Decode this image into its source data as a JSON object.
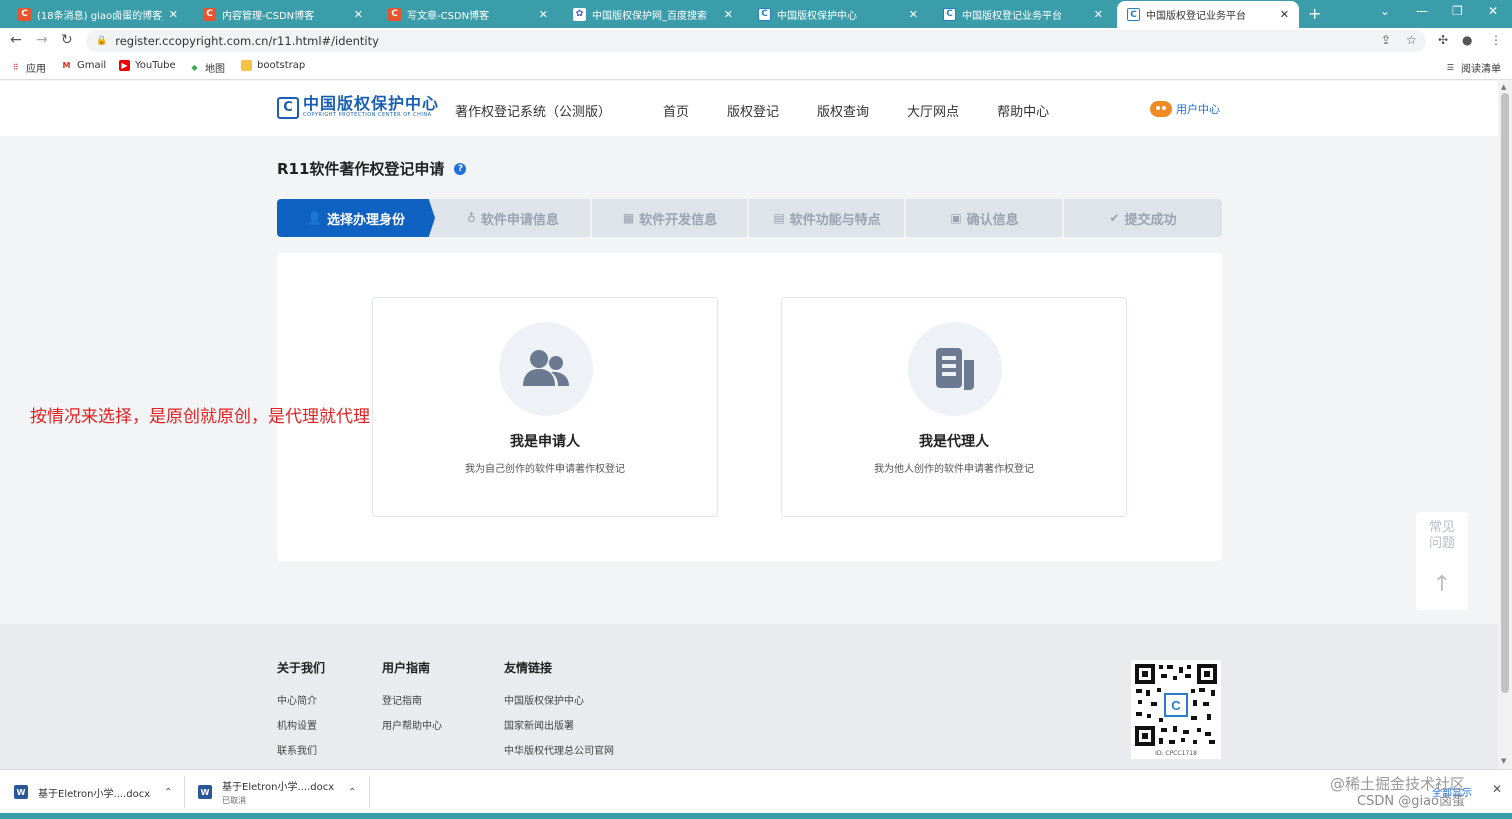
{
  "browser": {
    "tabs": [
      {
        "title": "(18条消息) giao卤蛋的博客_CSDN",
        "icon": "csdn-icon"
      },
      {
        "title": "内容管理-CSDN博客",
        "icon": "csdn-icon"
      },
      {
        "title": "写文章-CSDN博客",
        "icon": "csdn-icon"
      },
      {
        "title": "中国版权保护网_百度搜索",
        "icon": "baidu-icon"
      },
      {
        "title": "中国版权保护中心",
        "icon": "cpcc-icon"
      },
      {
        "title": "中国版权登记业务平台",
        "icon": "cpcc-icon"
      },
      {
        "title": "中国版权登记业务平台",
        "icon": "cpcc-icon"
      }
    ],
    "url": "register.ccopyright.com.cn/r11.html#/identity",
    "bookmarks": [
      {
        "label": "应用"
      },
      {
        "label": "Gmail"
      },
      {
        "label": "YouTube"
      },
      {
        "label": "地图"
      },
      {
        "label": "bootstrap"
      }
    ],
    "reading_list": "阅读清单"
  },
  "site": {
    "logo_text": "中国版权保护中心",
    "logo_sub": "COPYRIGHT PROTECTION CENTER OF CHINA",
    "logo_mark": "C",
    "system_name": "著作权登记系统（公测版）",
    "nav": [
      "首页",
      "版权登记",
      "版权查询",
      "大厅网点",
      "帮助中心"
    ],
    "user_center": "用户中心"
  },
  "page": {
    "title": "R11软件著作权登记申请",
    "help_mark": "?",
    "steps": [
      {
        "label": "选择办理身份",
        "icon": "user-icon",
        "active": true
      },
      {
        "label": "软件申请信息",
        "icon": "bulb-icon",
        "active": false
      },
      {
        "label": "软件开发信息",
        "icon": "calendar-icon",
        "active": false
      },
      {
        "label": "软件功能与特点",
        "icon": "document-icon",
        "active": false
      },
      {
        "label": "确认信息",
        "icon": "clipboard-icon",
        "active": false
      },
      {
        "label": "提交成功",
        "icon": "check-circle-icon",
        "active": false
      }
    ],
    "cards": [
      {
        "title": "我是申请人",
        "desc": "我为自己创作的软件申请著作权登记",
        "icon": "users-icon"
      },
      {
        "title": "我是代理人",
        "desc": "我为他人创作的软件申请著作权登记",
        "icon": "file-stack-icon"
      }
    ],
    "annotation": "按情况来选择，是原创就原创，是代理就代理",
    "float_help": {
      "label_line1": "常见",
      "label_line2": "问题",
      "top_arrow": "↑"
    }
  },
  "footer": {
    "columns": [
      {
        "heading": "关于我们",
        "links": [
          "中心简介",
          "机构设置",
          "联系我们"
        ]
      },
      {
        "heading": "用户指南",
        "links": [
          "登记指南",
          "用户帮助中心"
        ]
      },
      {
        "heading": "友情链接",
        "links": [
          "中国版权保护中心",
          "国家新闻出版署",
          "中华版权代理总公司官网"
        ]
      }
    ],
    "qr_id": "ID: CPCC1718"
  },
  "downloads": {
    "items": [
      {
        "name": "基于Eletron小学....docx",
        "status": ""
      },
      {
        "name": "基于Eletron小学....docx",
        "status": "已取消"
      }
    ],
    "show_all": "全部显示"
  },
  "watermark": {
    "line1": "@稀土掘金技术社区",
    "line2": "CSDN @giao卤蛋"
  },
  "colors": {
    "primary": "#0f62c2",
    "tabbar": "#3a9da9",
    "annotation": "#e02020",
    "brand": "#1a5fb4"
  }
}
